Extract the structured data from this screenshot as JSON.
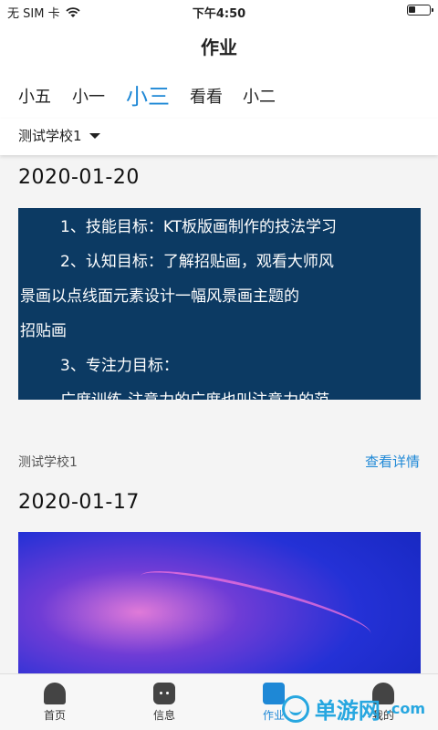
{
  "status_bar": {
    "carrier": "无 SIM 卡",
    "wifi_icon": "wifi-icon",
    "time": "下午4:50",
    "battery_level": 0.35
  },
  "nav": {
    "title": "作业"
  },
  "tabs": [
    {
      "label": "小五",
      "active": false
    },
    {
      "label": "小一",
      "active": false
    },
    {
      "label": "小三",
      "active": true
    },
    {
      "label": "看看",
      "active": false
    },
    {
      "label": "小二",
      "active": false
    }
  ],
  "school_filter": {
    "value": "测试学校1",
    "icon": "caret-down-icon"
  },
  "posts": [
    {
      "date": "2020-01-20",
      "image_text": [
        "1、技能目标：KT板版画制作的技法学习",
        "2、认知目标：了解招贴画，观看大师风",
        "景画以点线面元素设计一幅风景画主题的",
        "招贴画",
        "3、专注力目标：",
        "广度训练-注意力的广度也叫注意力的范"
      ],
      "school": "测试学校1",
      "detail_label": "查看详情"
    },
    {
      "date": "2020-01-17",
      "image": "jellyfish-photo"
    }
  ],
  "tabbar": [
    {
      "label": "首页",
      "icon": "home-icon",
      "active": false
    },
    {
      "label": "信息",
      "icon": "message-icon",
      "active": false
    },
    {
      "label": "作业",
      "icon": "homework-icon",
      "active": true
    },
    {
      "label": "我的",
      "icon": "profile-icon",
      "active": false
    }
  ],
  "watermark": {
    "text": "单游网",
    "suffix": ".com"
  },
  "colors": {
    "accent": "#1e88d6",
    "image_bg": "#0c3a63"
  }
}
